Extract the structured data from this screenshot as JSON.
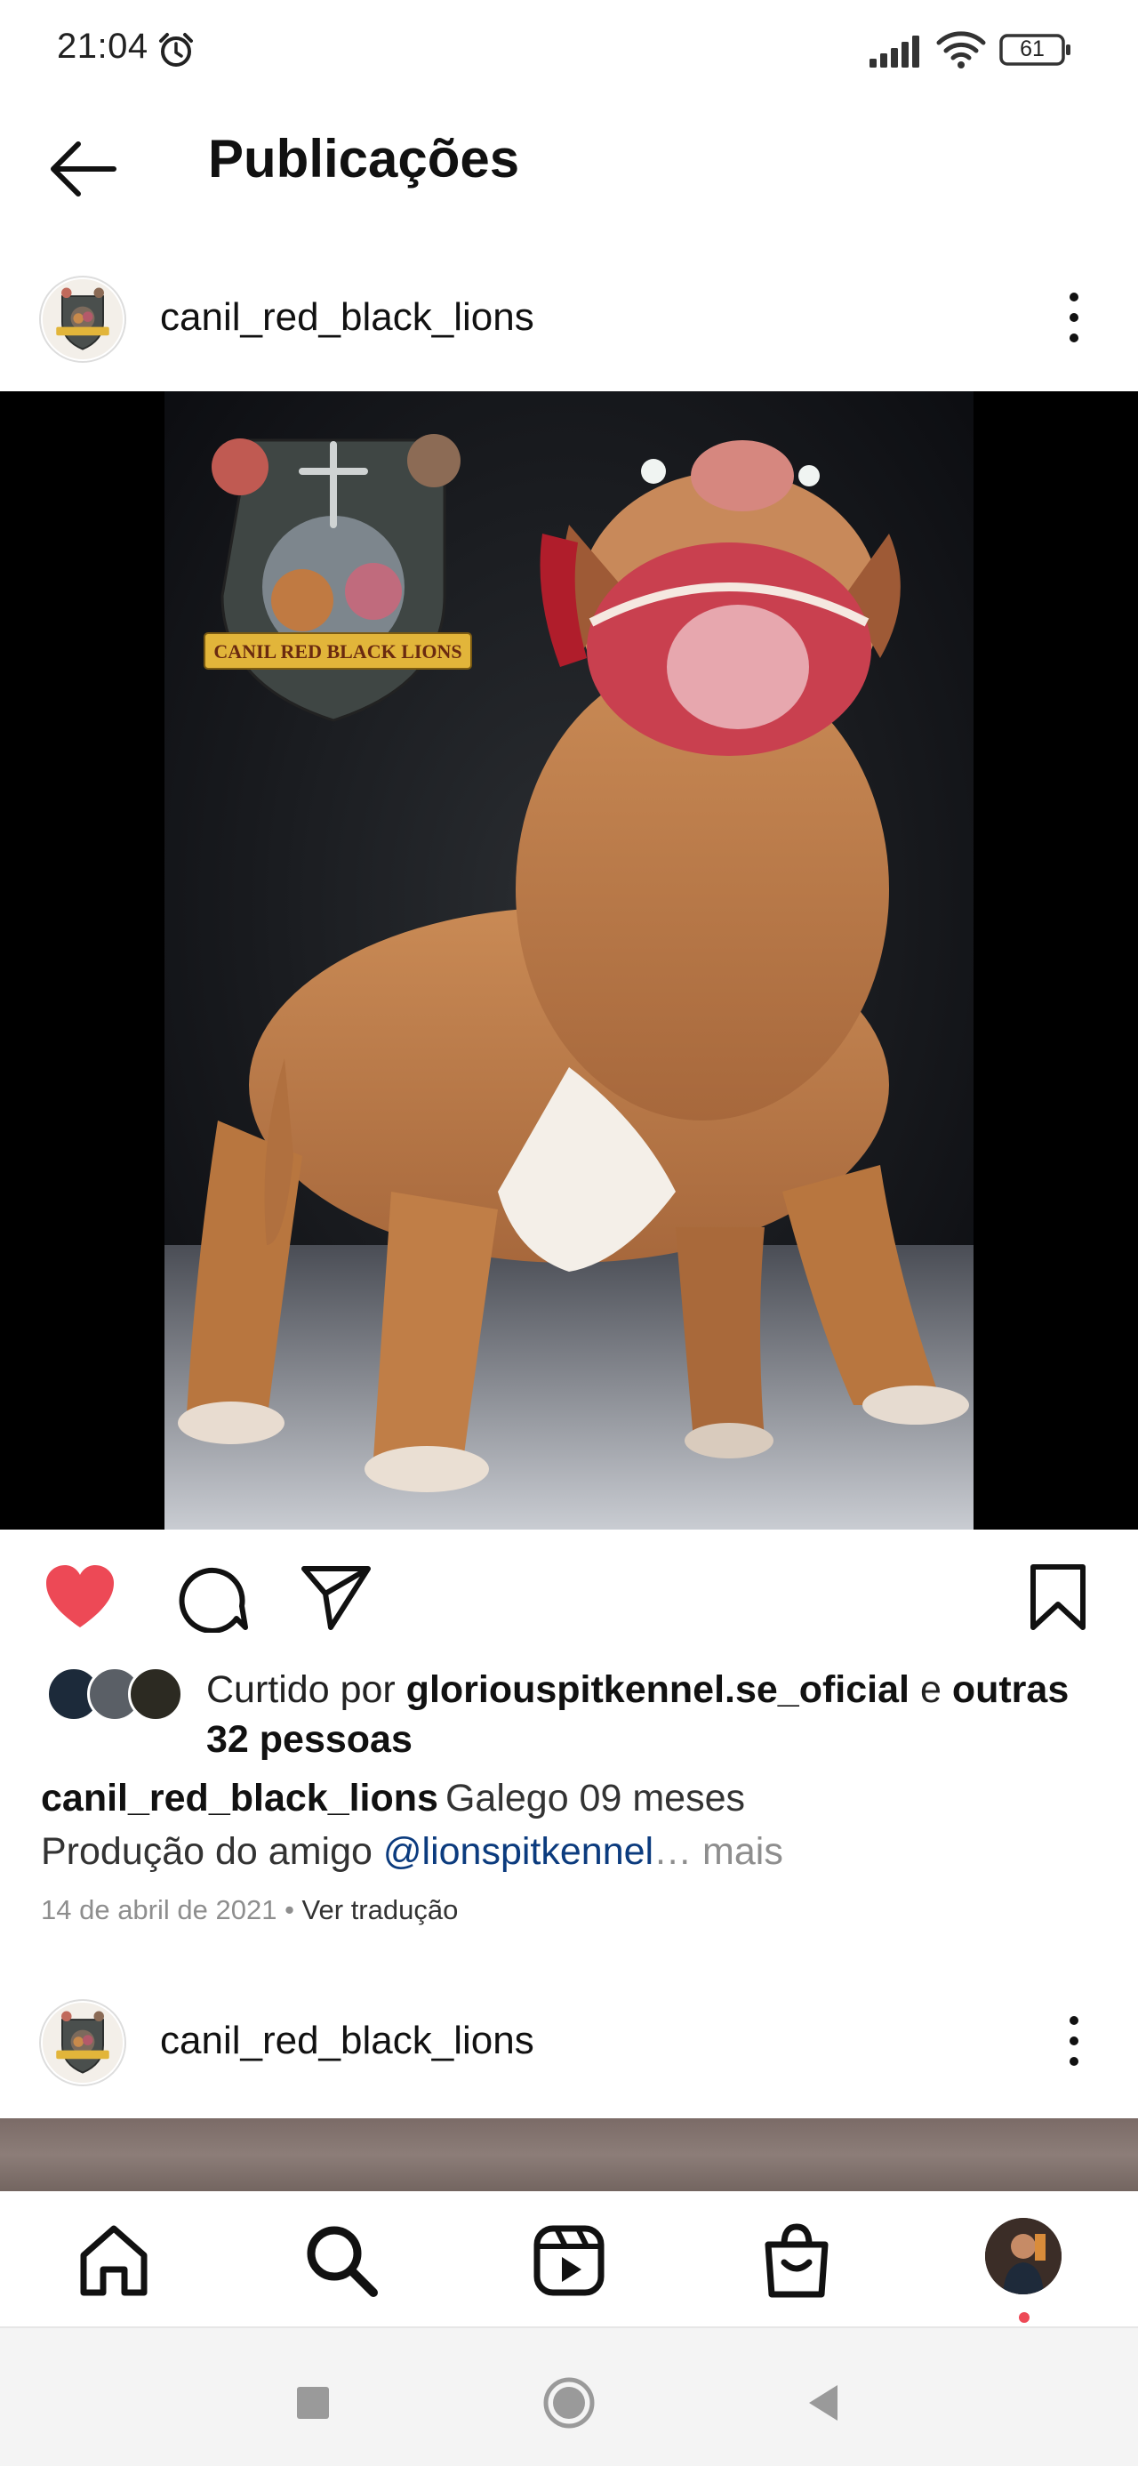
{
  "status_bar": {
    "time": "21:04",
    "battery": "61",
    "icons": [
      "alarm-icon",
      "signal-icon",
      "wifi-icon",
      "battery-icon"
    ]
  },
  "header": {
    "title": "Publicações",
    "back_icon": "arrow-left-icon"
  },
  "post": {
    "username": "canil_red_black_lions",
    "photo_logo_text": "CANIL RED BLACK LIONS",
    "liked": true,
    "likes": {
      "prefix": "Curtido por",
      "by": "gloriouspitkennel.se_oficial",
      "connector": "e",
      "others": "outras 32 pessoas"
    },
    "caption": {
      "user": "canil_red_black_lions",
      "line1": "Galego 09 meses",
      "line2_prefix": "Produção do amigo",
      "mention": "@lionspitkennel",
      "ellipsis": "…",
      "more": "mais"
    },
    "date": "14 de abril de 2021",
    "separator": "•",
    "translate": "Ver tradução",
    "colors": {
      "like": "#ed4956",
      "mention": "#0b3b7e",
      "muted": "#8e8e8e"
    }
  },
  "next_post": {
    "username": "canil_red_black_lions"
  },
  "bottom_nav": {
    "items": [
      "home-icon",
      "search-icon",
      "reels-icon",
      "shop-icon",
      "profile-avatar"
    ],
    "notification_color": "#ed4956"
  },
  "system_nav": {
    "items": [
      "recents-button",
      "home-button",
      "back-button"
    ]
  }
}
